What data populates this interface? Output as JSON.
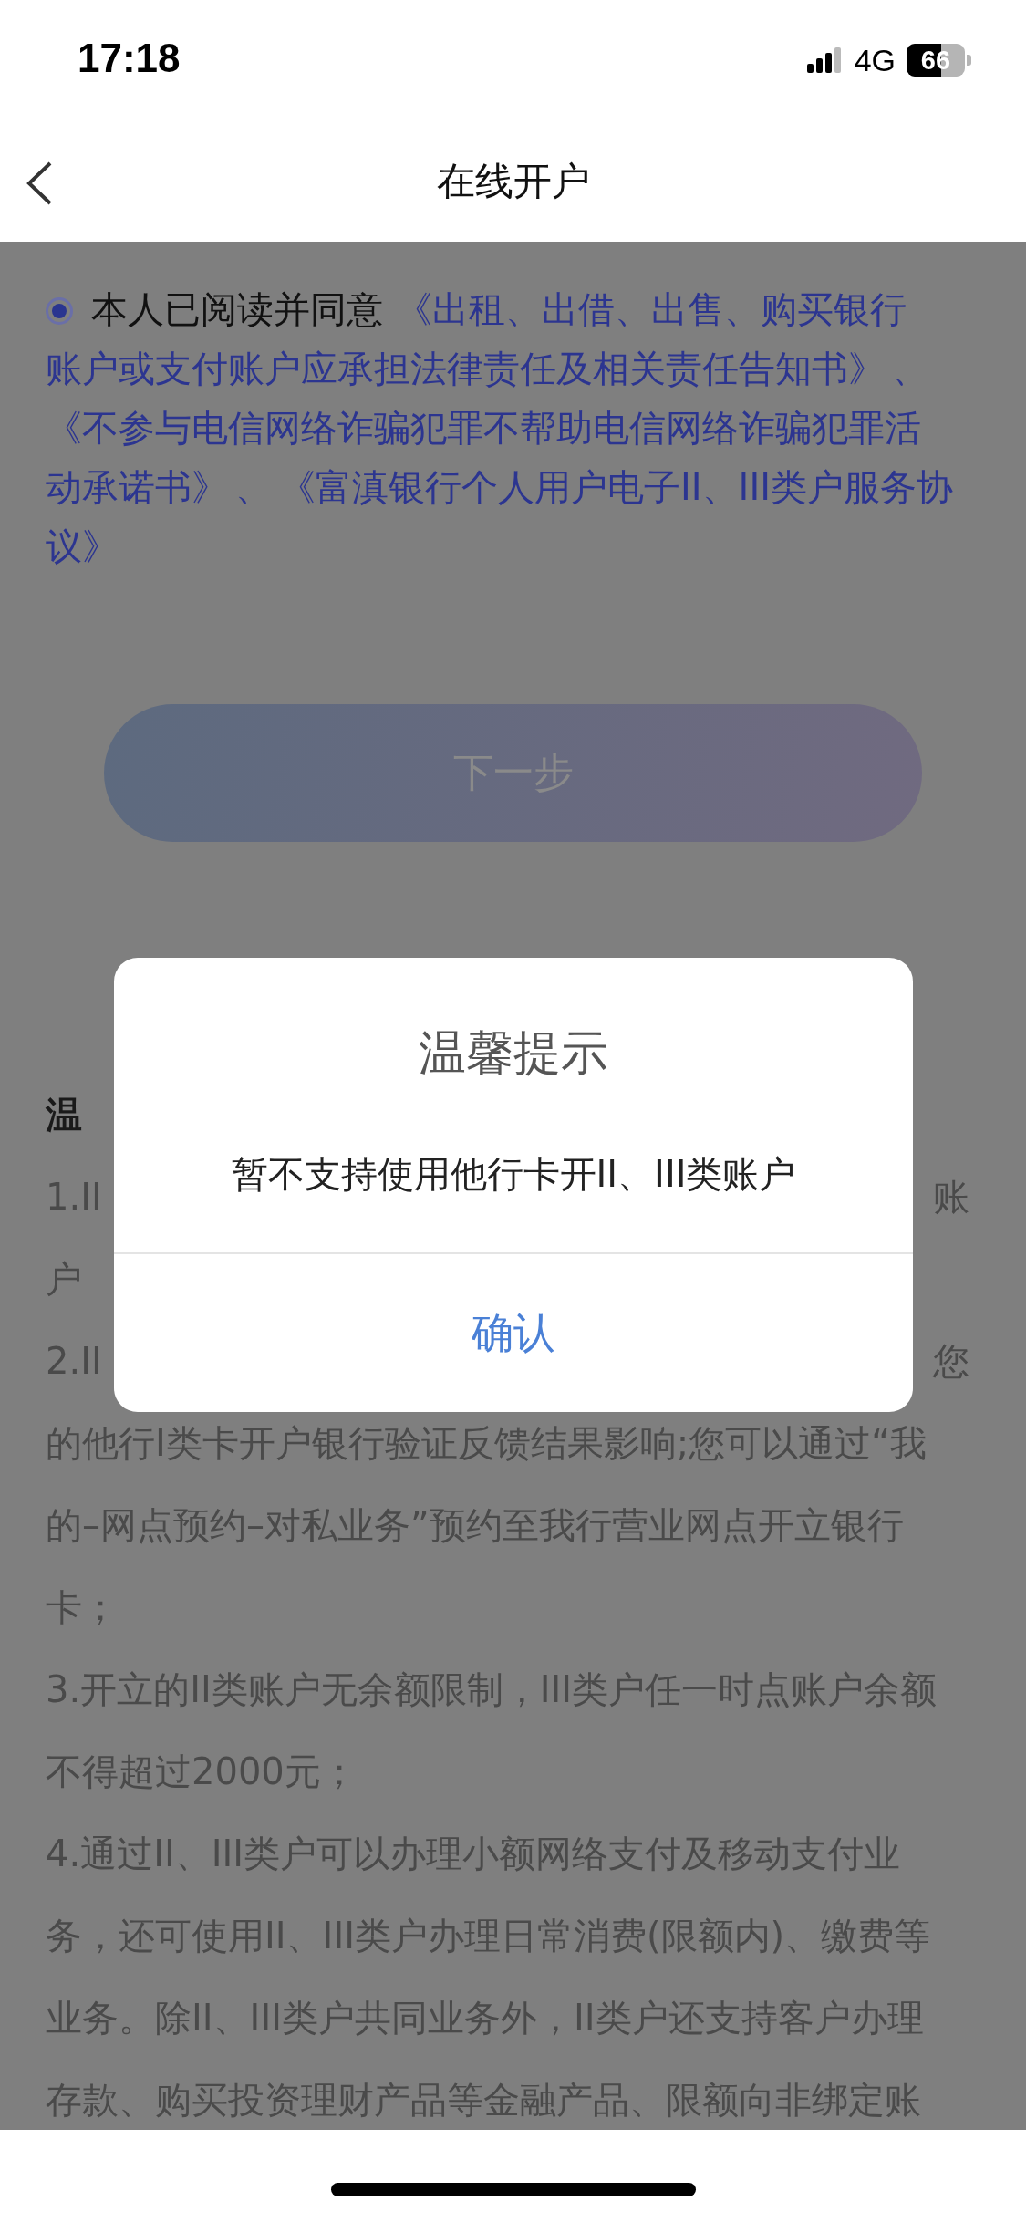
{
  "status_bar": {
    "time": "17:18",
    "network": "4G",
    "battery": "66"
  },
  "nav": {
    "title": "在线开户"
  },
  "agreement": {
    "checked": true,
    "label": "本人已阅读并同意",
    "lines": [
      [
        {
          "kind": "link",
          "text": "《出租、出借、出售、购买银行"
        }
      ],
      [
        {
          "kind": "link",
          "text": "账户或支付账户应承担法律责任及相关责任告知书》"
        },
        {
          "kind": "separator",
          "text": "、"
        }
      ],
      [
        {
          "kind": "link",
          "text": "《不参与电信网络诈骗犯罪不帮助电信网络诈骗犯罪活"
        }
      ],
      [
        {
          "kind": "link",
          "text": "动承诺书》"
        },
        {
          "kind": "separator",
          "text": "、"
        },
        {
          "kind": "link",
          "text": "《富滇银行个人用户电子II、III类户服务协"
        }
      ],
      [
        {
          "kind": "link",
          "text": "议》"
        }
      ]
    ]
  },
  "next_button": {
    "label": "下一步",
    "disabled": true
  },
  "hint": {
    "title": "温",
    "lines": [
      {
        "left": "1.II",
        "right": "账"
      },
      {
        "left": "户"
      },
      {
        "left": "2.II",
        "right": "您"
      },
      {
        "left": "的他行I类卡开户银行验证反馈结果影响;您可以通过“我"
      },
      {
        "left": "的–网点预约–对私业务”预约至我行营业网点开立银行"
      },
      {
        "left": "卡；"
      },
      {
        "left": "3.开立的II类账户无余额限制，III类户任一时点账户余额"
      },
      {
        "left": "不得超过2000元；"
      },
      {
        "left": "4.通过II、III类户可以办理小额网络支付及移动支付业"
      },
      {
        "left": "务，还可使用II、III类户办理日常消费(限额内)、缴费等"
      },
      {
        "left": "业务。除II、III类户共同业务外，II类户还支持客户办理"
      },
      {
        "left": "存款、购买投资理财产品等金融产品、限额向非绑定账"
      }
    ]
  },
  "dialog": {
    "title": "温馨提示",
    "message": "暂不支持使用他行卡开II、III类账户",
    "confirm": "确认"
  }
}
